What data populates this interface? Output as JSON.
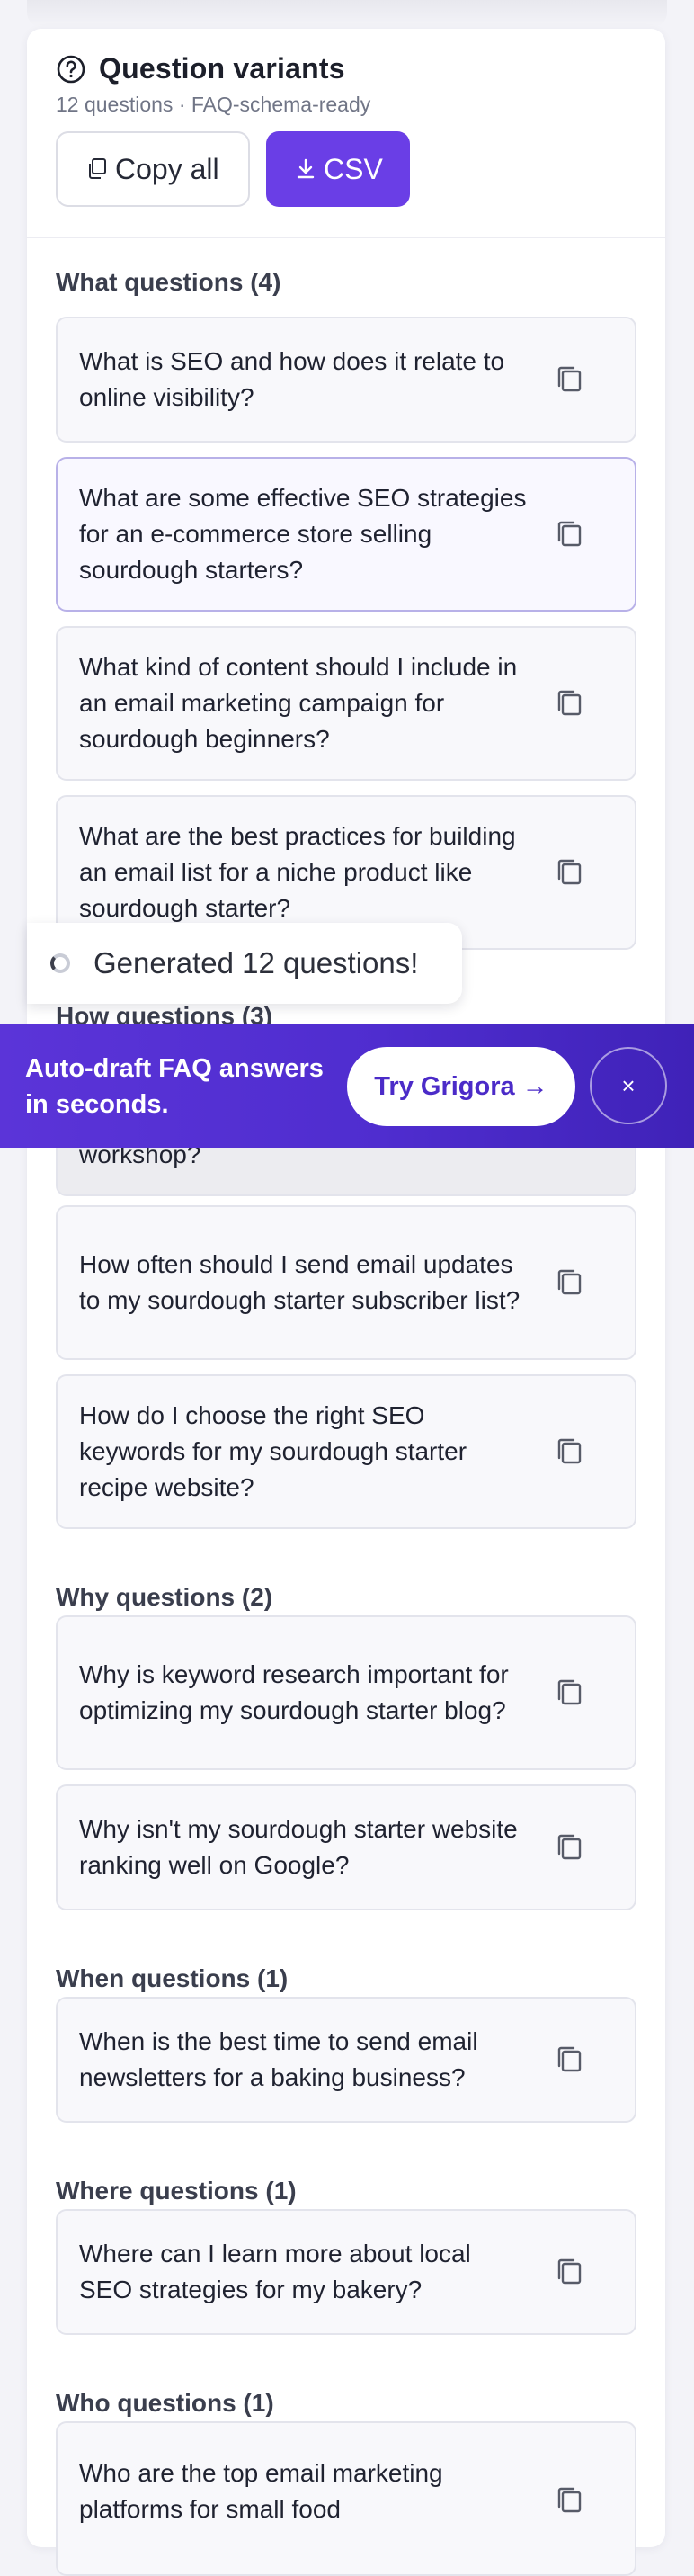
{
  "panel": {
    "title": "Question variants",
    "subtitle": "12 questions · FAQ-schema-ready",
    "copy_all_label": "Copy all",
    "csv_label": "CSV"
  },
  "sections": {
    "what": {
      "title": "What questions (4)",
      "items": [
        "What is SEO and how does it relate to online visibility?",
        "What are some effective SEO strategies for an e-commerce store selling sourdough starters?",
        "What kind of content should I include in an email marketing campaign for sourdough beginners?",
        "What are the best practices for building an email list for a niche product like sourdough starter?"
      ]
    },
    "how": {
      "title": "How questions (3)",
      "items": [
        "workshop?",
        "How often should I send email updates to my sourdough starter subscriber list?",
        "How do I choose the right SEO keywords for my sourdough starter recipe website?"
      ]
    },
    "why": {
      "title": "Why questions (2)",
      "items": [
        "Why is keyword research important for optimizing my sourdough starter blog?",
        "Why isn't my sourdough starter website ranking well on Google?"
      ]
    },
    "when": {
      "title": "When questions (1)",
      "items": [
        "When is the best time to send email newsletters for a baking business?"
      ]
    },
    "where": {
      "title": "Where questions (1)",
      "items": [
        "Where can I learn more about local SEO strategies for my bakery?"
      ]
    },
    "who": {
      "title": "Who questions (1)",
      "items": [
        "Who are the top email marketing platforms for small food"
      ]
    }
  },
  "toast": {
    "text": "Generated 12 questions!"
  },
  "banner": {
    "text": "Auto-draft FAQ answers in seconds.",
    "cta_label": "Try Grigora →",
    "close_label": "×"
  },
  "icons": {
    "title": "question-circle-icon",
    "copy_all": "copy-icon",
    "csv": "download-icon",
    "item_copy": "copy-icon"
  },
  "colors": {
    "accent": "#6a3ee6",
    "banner": "#5b34d8",
    "cta_text": "#4b2bc8"
  }
}
